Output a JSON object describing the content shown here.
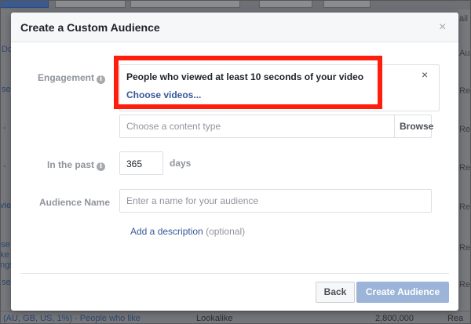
{
  "background": {
    "left_fragments": [
      "Do",
      "se",
      "-",
      "-",
      "vie",
      "se",
      "ke",
      "ngs",
      "se"
    ],
    "right_fragments": [
      "Aud",
      "Rea",
      "Rea",
      "Rea",
      "Rea",
      "Rea",
      "Rea",
      "Rea",
      "Rea"
    ],
    "right_top": "ail",
    "bottom_row": {
      "name": "(AU, GB, US, 1%) - People who like",
      "type": "Lookalike",
      "size": "2,800,000",
      "status": "Rea"
    }
  },
  "dialog": {
    "title": "Create a Custom Audience",
    "close_glyph": "×",
    "engagement": {
      "label": "Engagement",
      "selected_title": "People who viewed at least 10 seconds of your video",
      "choose_link": "Choose videos...",
      "remove_glyph": "×",
      "content_type_placeholder": "Choose a content type",
      "browse_label": "Browse"
    },
    "in_the_past": {
      "label": "In the past",
      "value": "365",
      "suffix": "days"
    },
    "audience_name": {
      "label": "Audience Name",
      "placeholder": "Enter a name for your audience"
    },
    "description": {
      "link": "Add a description",
      "optional": "(optional)"
    },
    "footer": {
      "back_label": "Back",
      "create_label": "Create Audience"
    }
  },
  "colors": {
    "highlight": "#ff1e0b",
    "link": "#365899",
    "primary_disabled": "#9cb4d8"
  },
  "info_glyph": "i"
}
